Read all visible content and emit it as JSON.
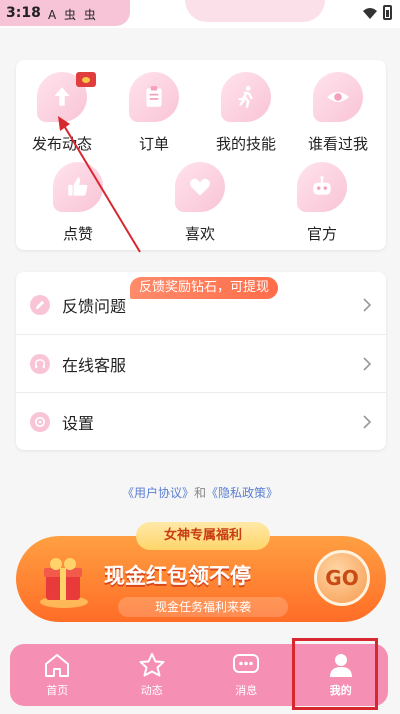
{
  "status_bar": {
    "time": "3:18",
    "left_icons": "A 虫 虫"
  },
  "grid": {
    "items": [
      {
        "label": "发布动态",
        "icon": "upload-arrow-icon"
      },
      {
        "label": "订单",
        "icon": "clipboard-icon"
      },
      {
        "label": "我的技能",
        "icon": "running-person-icon"
      },
      {
        "label": "谁看过我",
        "icon": "eye-icon"
      },
      {
        "label": "点赞",
        "icon": "thumbs-up-icon"
      },
      {
        "label": "喜欢",
        "icon": "heart-hands-icon"
      },
      {
        "label": "官方",
        "icon": "robot-icon"
      }
    ]
  },
  "menu": {
    "badge": "反馈奖励钻石，可提现",
    "items": [
      {
        "label": "反馈问题",
        "icon": "edit-icon"
      },
      {
        "label": "在线客服",
        "icon": "headset-icon"
      },
      {
        "label": "设置",
        "icon": "gear-icon"
      }
    ]
  },
  "agreement": {
    "user_agreement": "《用户协议》",
    "and": "和",
    "privacy_policy": "《隐私政策》"
  },
  "promo": {
    "tab": "女神专属福利",
    "title": "现金红包领不停",
    "subtitle": "现金任务福利来袭",
    "go": "GO"
  },
  "nav": {
    "items": [
      {
        "label": "首页",
        "icon": "home-icon"
      },
      {
        "label": "动态",
        "icon": "star-icon"
      },
      {
        "label": "消息",
        "icon": "chat-bubble-icon"
      },
      {
        "label": "我的",
        "icon": "person-icon"
      }
    ]
  },
  "colors": {
    "accent_pink": "#f58fb4",
    "promo_orange": "#ff6d26",
    "highlight_red": "#d8282f"
  }
}
